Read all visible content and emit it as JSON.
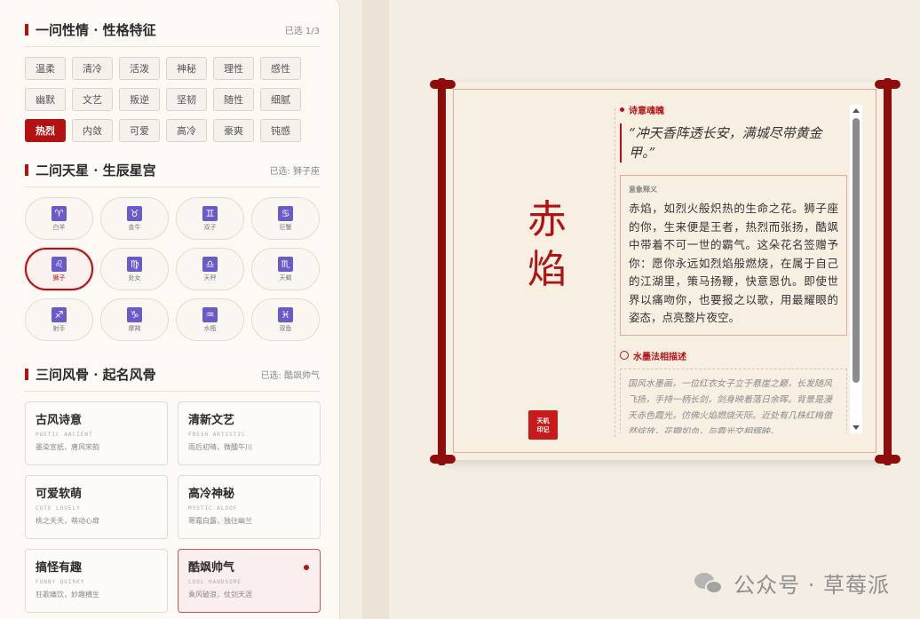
{
  "section1": {
    "title": "一问性情 · 性格特征",
    "meta": "已选 1/3",
    "chips": [
      {
        "label": "温柔",
        "active": false
      },
      {
        "label": "清冷",
        "active": false
      },
      {
        "label": "活泼",
        "active": false
      },
      {
        "label": "神秘",
        "active": false
      },
      {
        "label": "理性",
        "active": false
      },
      {
        "label": "感性",
        "active": false
      },
      {
        "label": "幽默",
        "active": false
      },
      {
        "label": "文艺",
        "active": false
      },
      {
        "label": "叛逆",
        "active": false
      },
      {
        "label": "坚韧",
        "active": false
      },
      {
        "label": "随性",
        "active": false
      },
      {
        "label": "细腻",
        "active": false
      },
      {
        "label": "热烈",
        "active": true
      },
      {
        "label": "内敛",
        "active": false
      },
      {
        "label": "可爱",
        "active": false
      },
      {
        "label": "高冷",
        "active": false
      },
      {
        "label": "豪爽",
        "active": false
      },
      {
        "label": "钝感",
        "active": false
      }
    ]
  },
  "section2": {
    "title": "二问天星 · 生辰星宫",
    "meta": "已选: 狮子座",
    "stars": [
      {
        "glyph": "♈",
        "name": "白羊",
        "icon": "aries-icon",
        "active": false
      },
      {
        "glyph": "♉",
        "name": "金牛",
        "icon": "taurus-icon",
        "active": false
      },
      {
        "glyph": "♊",
        "name": "双子",
        "icon": "gemini-icon",
        "active": false
      },
      {
        "glyph": "♋",
        "name": "巨蟹",
        "icon": "cancer-icon",
        "active": false
      },
      {
        "glyph": "♌",
        "name": "狮子",
        "icon": "leo-icon",
        "active": true
      },
      {
        "glyph": "♍",
        "name": "处女",
        "icon": "virgo-icon",
        "active": false
      },
      {
        "glyph": "♎",
        "name": "天秤",
        "icon": "libra-icon",
        "active": false
      },
      {
        "glyph": "♏",
        "name": "天蝎",
        "icon": "scorpio-icon",
        "active": false
      },
      {
        "glyph": "♐",
        "name": "射手",
        "icon": "sagittarius-icon",
        "active": false
      },
      {
        "glyph": "♑",
        "name": "摩羯",
        "icon": "capricorn-icon",
        "active": false
      },
      {
        "glyph": "♒",
        "name": "水瓶",
        "icon": "aquarius-icon",
        "active": false
      },
      {
        "glyph": "♓",
        "name": "双鱼",
        "icon": "pisces-icon",
        "active": false
      }
    ]
  },
  "section3": {
    "title": "三问风骨 · 起名风骨",
    "meta": "已选: 酷飒帅气",
    "styles": [
      {
        "cn": "古风诗意",
        "en": "POETIC ANCIENT",
        "desc": "墨染宣纸，唐风宋韵",
        "active": false
      },
      {
        "cn": "清新文艺",
        "en": "FRESH ARTISTIC",
        "desc": "雨后初晴，微醺午川",
        "active": false
      },
      {
        "cn": "可爱软萌",
        "en": "CUTE LOVELY",
        "desc": "桃之夭夭，萌动心扉",
        "active": false
      },
      {
        "cn": "高冷神秘",
        "en": "MYSTIC ALOOF",
        "desc": "寒霜白露，独往幽兰",
        "active": false
      },
      {
        "cn": "搞怪有趣",
        "en": "FUNNY QUIRKY",
        "desc": "狂歌痛饮，妙趣横生",
        "active": false
      },
      {
        "cn": "酷飒帅气",
        "en": "COOL HANDSOME",
        "desc": "乘风破浪，仗剑天涯",
        "active": true
      }
    ]
  },
  "scroll": {
    "title_line1": "赤",
    "title_line2": "焰",
    "seal_line1": "天机",
    "seal_line2": "印记",
    "poem_label": "诗意魂魄",
    "poem": "“冲天香阵透长安，满城尽带黄金甲。”",
    "meaning_tag": "意象释义",
    "meaning": "赤焰，如烈火般炽热的生命之花。狮子座的你，生来便是王者，热烈而张扬，酷飒中带着不可一世的霸气。这朵花名签赠予你：愿你永远如烈焰般燃烧，在属于自己的江湖里，策马扬鞭，快意恩仇。即使世界以痛吻你，也要报之以歌，用最耀眼的姿态，点亮整片夜空。",
    "ink_label": "水墨法相描述",
    "ink_text": "国风水墨画，一位红衣女子立于悬崖之巅，长发随风飞扬，手持一柄长剑，剑身映着落日余晖。背景是漫天赤色霞光，仿佛火焰燃烧天际。近处有几株红梅傲然绽放，花瓣如血，与霞光交相辉映。"
  },
  "watermark": {
    "text": "公众号 · 草莓派"
  },
  "colors": {
    "accent": "#b31212",
    "zodiac_tile": "#6b5bc9"
  }
}
